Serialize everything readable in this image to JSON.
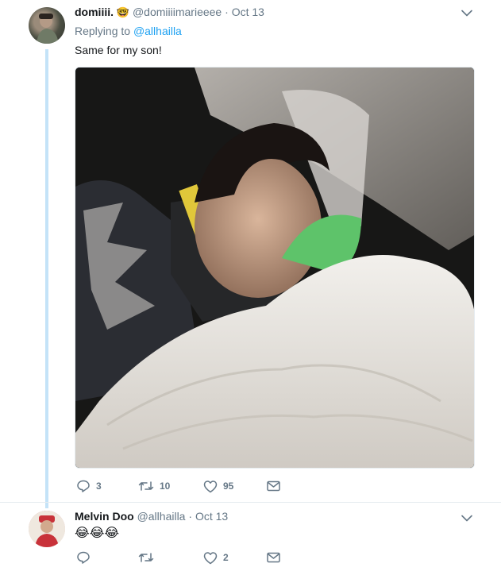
{
  "tweets": [
    {
      "author_name": "domiiii.",
      "author_emoji": "🤓",
      "handle": "@domiiiimarieeee",
      "separator": "·",
      "date": "Oct 13",
      "replying_prefix": "Replying to",
      "replying_to": "@allhailla",
      "text": "Same for my son!",
      "replies": "3",
      "retweets": "10",
      "likes": "95"
    },
    {
      "author_name": "Melvin Doo",
      "handle": "@allhailla",
      "separator": "·",
      "date": "Oct 13",
      "text": "😂😂😂",
      "replies": "",
      "retweets": "",
      "likes": "2"
    }
  ],
  "colors": {
    "link": "#1da1f2",
    "secondary_text": "#657786",
    "thread_line": "#c4e3f8",
    "divider": "#e6ecf0"
  },
  "icons": {
    "caret": "chevron-down-icon",
    "reply": "reply-icon",
    "retweet": "retweet-icon",
    "like": "heart-icon",
    "dm": "envelope-icon"
  }
}
